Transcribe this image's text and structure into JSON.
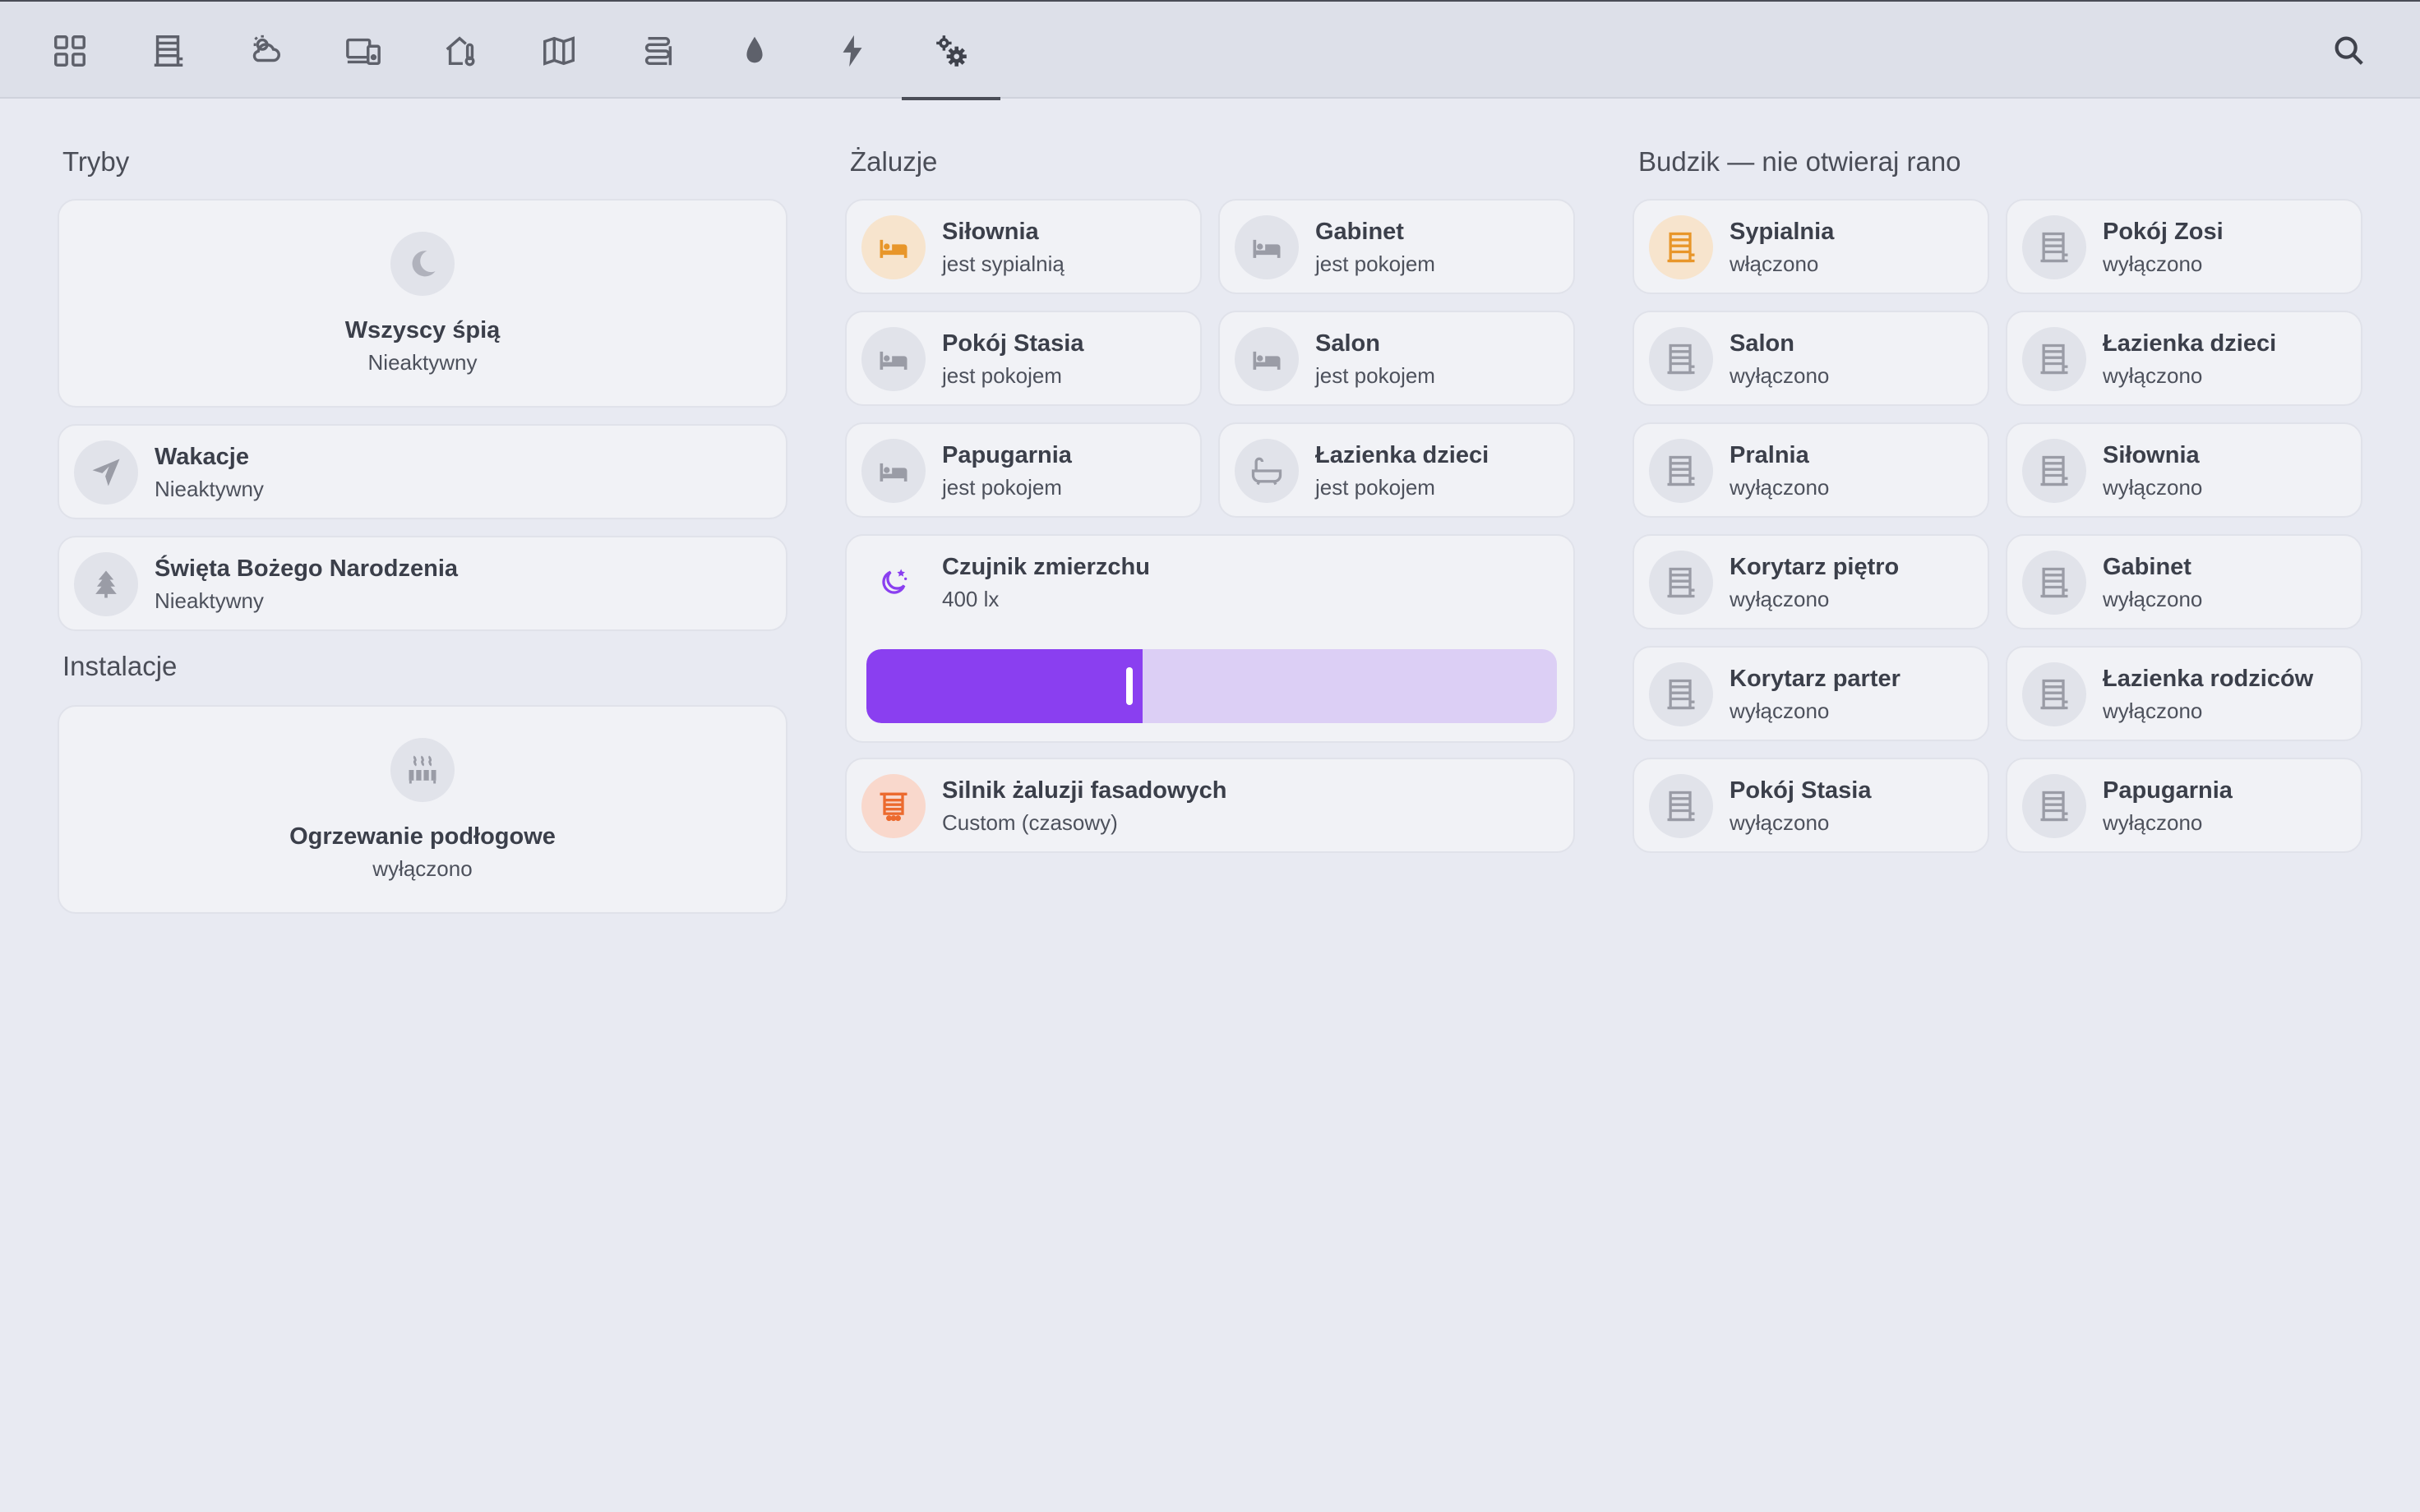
{
  "colors": {
    "accent_purple": "#8a3ff0",
    "slider_track": "#dccff5",
    "orange_icon": "#e8962a",
    "red_icon": "#ec6a2e",
    "gray_icon": "#9a9ca6"
  },
  "topbar": {
    "tabs": [
      {
        "icon": "grid-icon"
      },
      {
        "icon": "building-icon"
      },
      {
        "icon": "weather-icon"
      },
      {
        "icon": "devices-icon"
      },
      {
        "icon": "home-thermometer-icon"
      },
      {
        "icon": "map-icon"
      },
      {
        "icon": "heating-coil-icon"
      },
      {
        "icon": "water-drop-icon"
      },
      {
        "icon": "lightning-icon"
      },
      {
        "icon": "settings-cogs-icon",
        "active": true
      }
    ],
    "search_icon": "search-icon"
  },
  "modes": {
    "title": "Tryby",
    "all_sleep": {
      "name": "Wszyscy śpią",
      "state": "Nieaktywny",
      "icon": "moon-icon"
    },
    "items": [
      {
        "name": "Wakacje",
        "state": "Nieaktywny",
        "icon": "airplane-icon"
      },
      {
        "name": "Święta Bożego Narodzenia",
        "state": "Nieaktywny",
        "icon": "pine-tree-icon"
      }
    ]
  },
  "installations": {
    "title": "Instalacje",
    "floor_heating": {
      "name": "Ogrzewanie podłogowe",
      "state": "wyłączono",
      "icon": "radiator-icon"
    }
  },
  "blinds": {
    "title": "Żaluzje",
    "items": [
      {
        "name": "Siłownia",
        "state": "jest sypialnią",
        "icon": "bed-icon",
        "highlight": "orange"
      },
      {
        "name": "Gabinet",
        "state": "jest pokojem",
        "icon": "bed-icon"
      },
      {
        "name": "Pokój Stasia",
        "state": "jest pokojem",
        "icon": "bed-icon"
      },
      {
        "name": "Salon",
        "state": "jest pokojem",
        "icon": "bed-icon"
      },
      {
        "name": "Papugarnia",
        "state": "jest pokojem",
        "icon": "bed-icon"
      },
      {
        "name": "Łazienka dzieci",
        "state": "jest pokojem",
        "icon": "bathtub-icon"
      }
    ],
    "dusk_sensor": {
      "name": "Czujnik zmierzchu",
      "state": "400 lx",
      "icon": "moon-stars-icon",
      "slider_fraction": 0.4
    },
    "facade_motor": {
      "name": "Silnik żaluzji fasadowych",
      "state": "Custom (czasowy)",
      "icon": "blinds-icon"
    }
  },
  "alarm": {
    "title": "Budzik — nie otwieraj rano",
    "items": [
      {
        "name": "Sypialnia",
        "state": "włączono",
        "icon": "blinds-open-icon",
        "highlight": "orange"
      },
      {
        "name": "Pokój Zosi",
        "state": "wyłączono",
        "icon": "blinds-open-icon"
      },
      {
        "name": "Salon",
        "state": "wyłączono",
        "icon": "blinds-open-icon"
      },
      {
        "name": "Łazienka dzieci",
        "state": "wyłączono",
        "icon": "blinds-open-icon"
      },
      {
        "name": "Pralnia",
        "state": "wyłączono",
        "icon": "blinds-open-icon"
      },
      {
        "name": "Siłownia",
        "state": "wyłączono",
        "icon": "blinds-open-icon"
      },
      {
        "name": "Korytarz piętro",
        "state": "wyłączono",
        "icon": "blinds-open-icon"
      },
      {
        "name": "Gabinet",
        "state": "wyłączono",
        "icon": "blinds-open-icon"
      },
      {
        "name": "Korytarz parter",
        "state": "wyłączono",
        "icon": "blinds-open-icon"
      },
      {
        "name": "Łazienka rodziców",
        "state": "wyłączono",
        "icon": "blinds-open-icon"
      },
      {
        "name": "Pokój Stasia",
        "state": "wyłączono",
        "icon": "blinds-open-icon"
      },
      {
        "name": "Papugarnia",
        "state": "wyłączono",
        "icon": "blinds-open-icon"
      }
    ]
  }
}
